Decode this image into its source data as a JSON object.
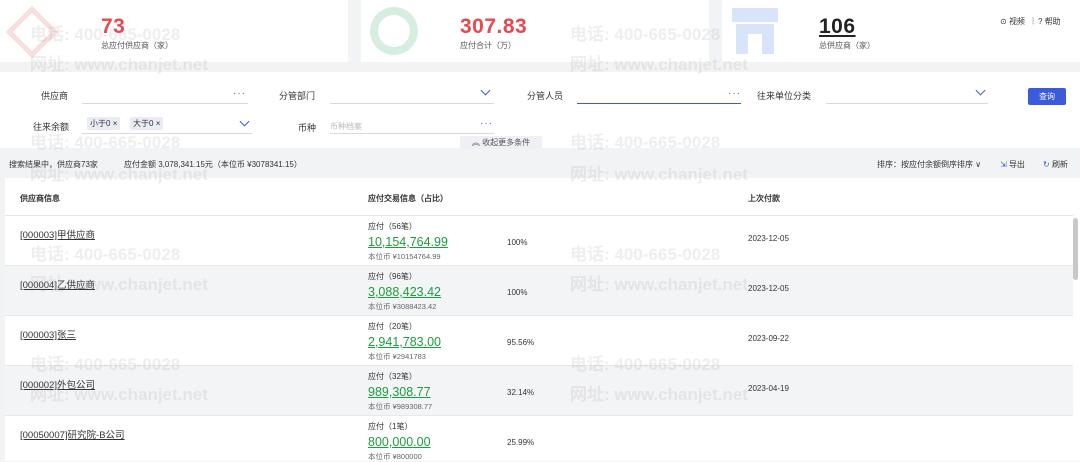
{
  "stats": [
    {
      "value": "73",
      "label": "总应付供应商（家）",
      "color": "#e8484e"
    },
    {
      "value": "307.83",
      "label": "应付合计（万）",
      "color": "#e8484e"
    },
    {
      "value": "106",
      "label": "总供应商（家）",
      "color": "#222222"
    }
  ],
  "header_links": {
    "video": "视频",
    "help": "帮助",
    "separator": "|"
  },
  "filters": {
    "supplier_label": "供应商",
    "dept_label": "分管部门",
    "staff_label": "分管人员",
    "category_label": "往来单位分类",
    "balance_label": "往来余额",
    "balance_tags": [
      "小于0",
      "大于0"
    ],
    "currency_label": "币种",
    "currency_placeholder": "币种档案",
    "query_button": "查询",
    "collapse_label": "收起更多条件",
    "dots": "···"
  },
  "summary": {
    "result_text": "搜索结果中，供应商73家",
    "amount_text": "应付金额 3,078,341.15元（本位币 ¥3078341.15）",
    "sort_text": "排序：按应付余额倒序排序",
    "export_label": "导出",
    "refresh_label": "刷新"
  },
  "table": {
    "headers": [
      "供应商信息",
      "应付交易信息（占比）",
      "上次付款"
    ],
    "rows": [
      {
        "name": "[000003]甲供应商",
        "trade": "应付（56笔）",
        "amount": "10,154,764.99",
        "base": "本位币 ¥10154764.99",
        "pct": "100%",
        "date": "2023-12-05"
      },
      {
        "name": "[000004]乙供应商",
        "trade": "应付（96笔）",
        "amount": "3,088,423.42",
        "base": "本位币 ¥3088423.42",
        "pct": "100%",
        "date": "2023-12-05"
      },
      {
        "name": "[000003]张三",
        "trade": "应付（20笔）",
        "amount": "2,941,783.00",
        "base": "本位币 ¥2941783",
        "pct": "95.56%",
        "date": "2023-09-22"
      },
      {
        "name": "[000002]外包公司",
        "trade": "应付（32笔）",
        "amount": "989,308.77",
        "base": "本位币 ¥989308.77",
        "pct": "32.14%",
        "date": "2023-04-19"
      },
      {
        "name": "[00050007]研究院-B公司",
        "trade": "应付（1笔）",
        "amount": "800,000.00",
        "base": "本位币 ¥800000",
        "pct": "25.99%",
        "date": ""
      }
    ]
  },
  "watermark": {
    "phone": "电话: 400-665-0028",
    "site": "网址: www.chanjet.net"
  }
}
